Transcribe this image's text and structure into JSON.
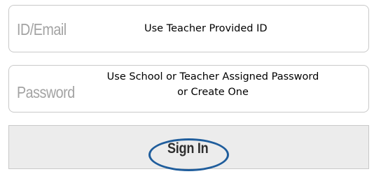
{
  "login_form": {
    "id_field": {
      "placeholder": "ID/Email",
      "annotation": "Use Teacher Provided ID"
    },
    "password_field": {
      "placeholder": "Password",
      "annotation_line1": "Use School or Teacher Assigned Password",
      "annotation_line2": "or Create One"
    },
    "sign_in_button": {
      "label": "Sign In"
    }
  },
  "colors": {
    "annotation_ring": "#1f5d9c",
    "button_background": "#ececec",
    "field_border": "#c9c9c9",
    "placeholder_text": "#a3a3a3"
  }
}
